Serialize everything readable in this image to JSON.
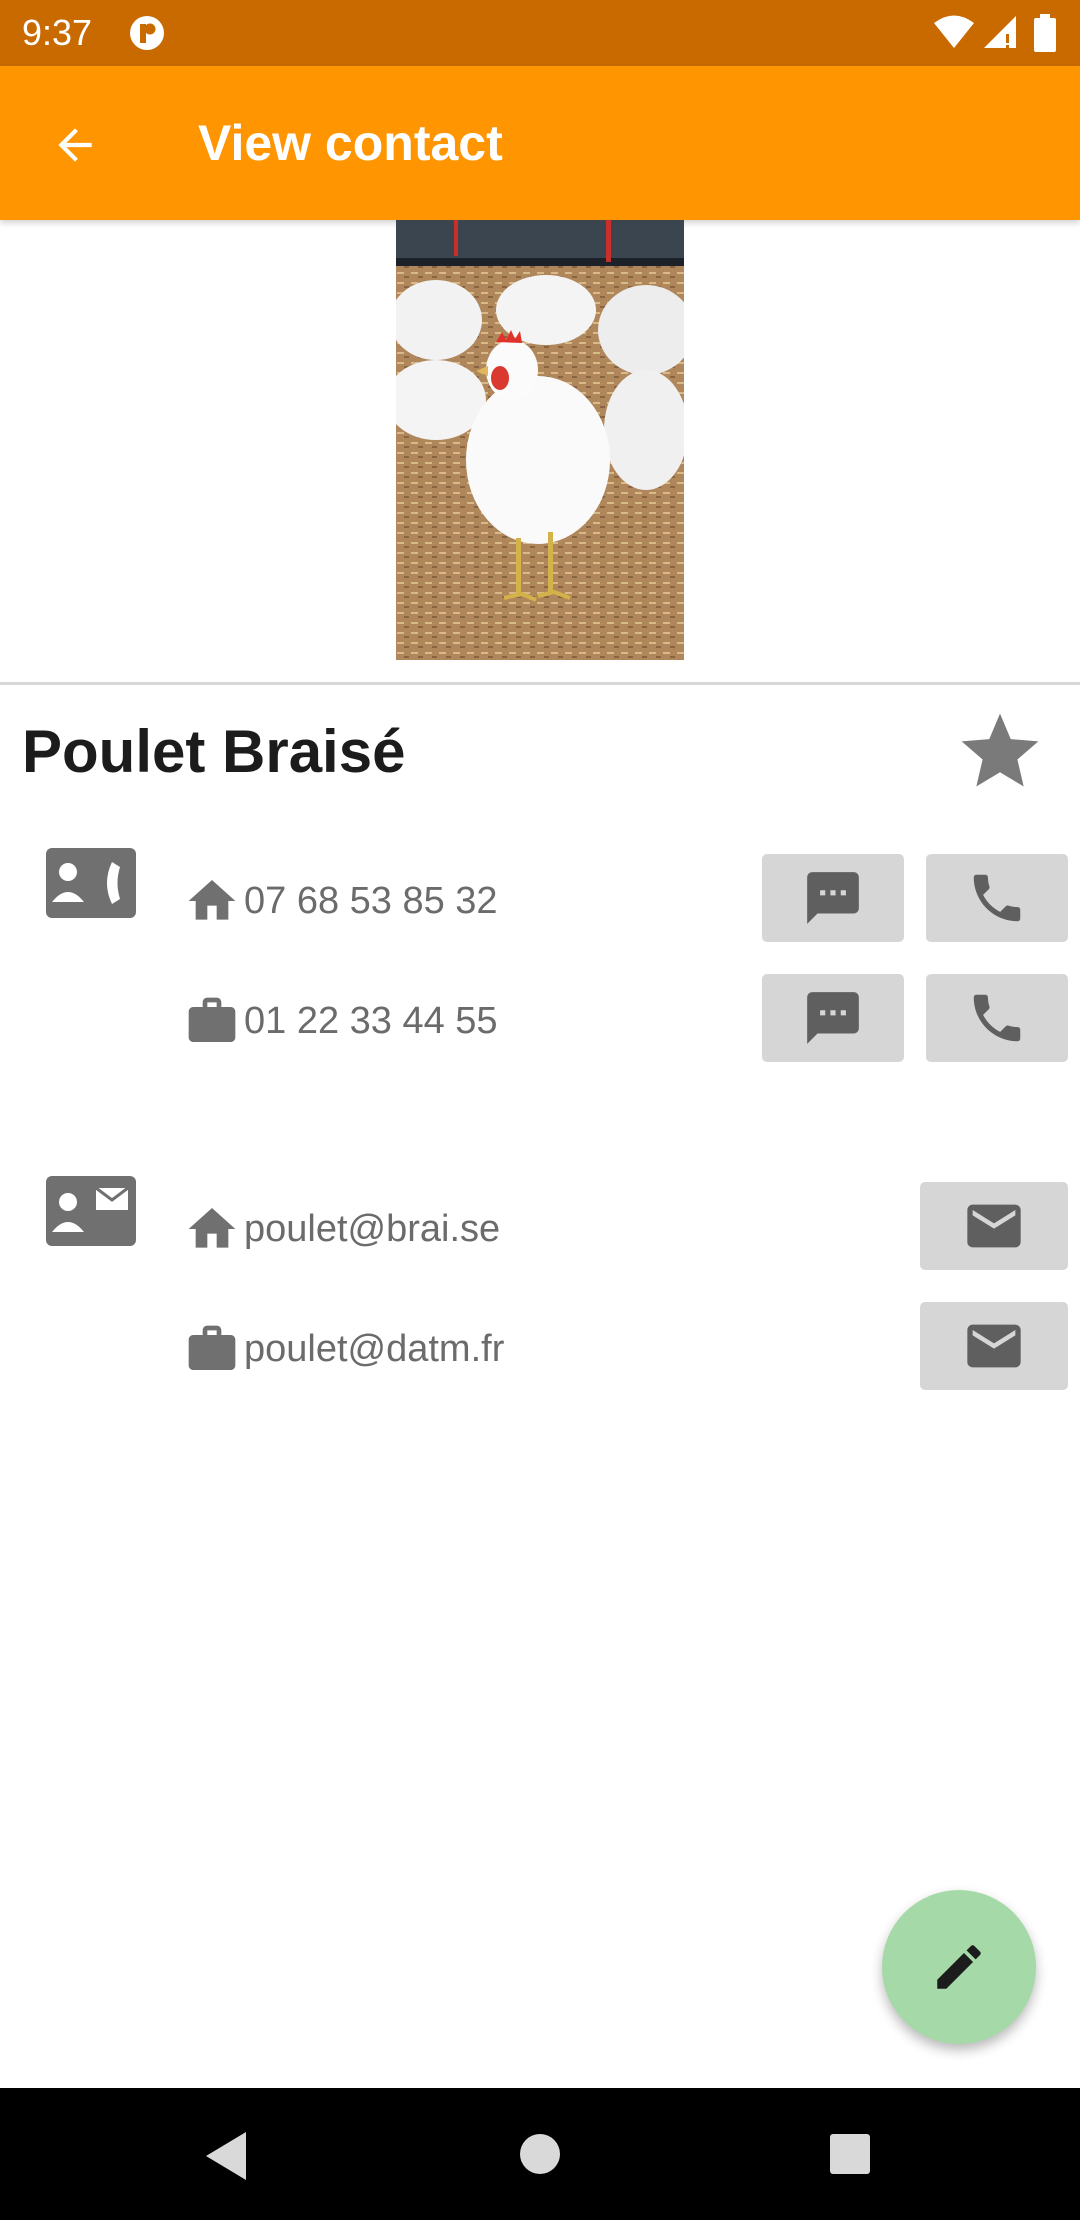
{
  "status_bar": {
    "time": "9:37"
  },
  "app_bar": {
    "title": "View contact"
  },
  "contact": {
    "name": "Poulet Braisé"
  },
  "phones": [
    {
      "type": "home",
      "number": "07 68 53 85 32"
    },
    {
      "type": "work",
      "number": "01 22 33 44 55"
    }
  ],
  "emails": [
    {
      "type": "home",
      "address": "poulet@brai.se"
    },
    {
      "type": "work",
      "address": "poulet@datm.fr"
    }
  ],
  "icons": {
    "back": "arrow-left-icon",
    "favorite": "star-icon",
    "phone_section": "contact-phone-icon",
    "email_section": "contact-mail-icon",
    "home": "home-icon",
    "work": "briefcase-icon",
    "sms": "message-icon",
    "call": "phone-icon",
    "email": "mail-icon",
    "edit": "pencil-icon"
  },
  "colors": {
    "status_bar": "#c86a00",
    "app_bar": "#ff9500",
    "fab": "#a5d9a7",
    "action_button": "#d6d6d6",
    "icon_gray": "#707070"
  }
}
